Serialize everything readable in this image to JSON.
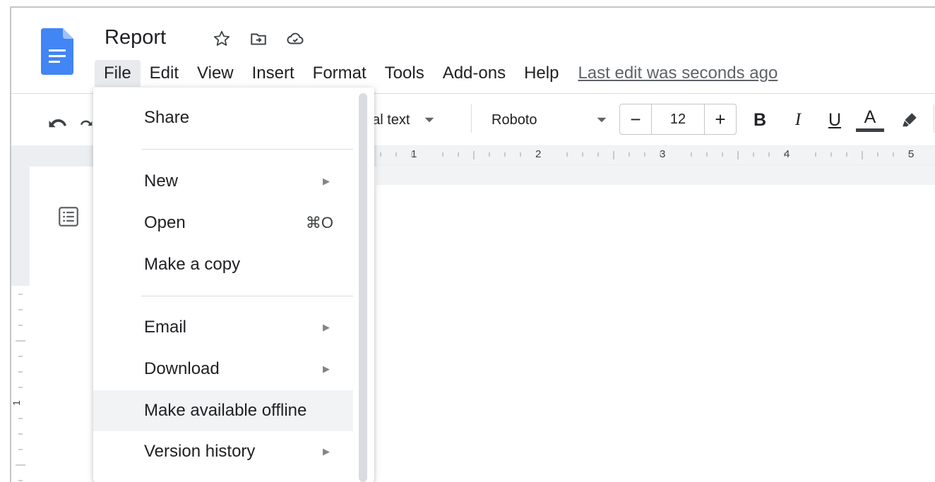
{
  "app": {
    "title": "Report",
    "last_edit": "Last edit was seconds ago"
  },
  "menubar": {
    "items": [
      "File",
      "Edit",
      "View",
      "Insert",
      "Format",
      "Tools",
      "Add-ons",
      "Help"
    ]
  },
  "toolbar": {
    "style_label": "nal text",
    "font_label": "Roboto",
    "font_size": "12",
    "minus": "−",
    "plus": "+",
    "bold": "B",
    "italic": "I",
    "underline": "U",
    "text_color": "A"
  },
  "ruler": {
    "numbers": [
      "1",
      "2",
      "3",
      "4",
      "5"
    ],
    "left_number": "1"
  },
  "file_menu": {
    "items": [
      {
        "label": "Share"
      },
      {
        "label": "New"
      },
      {
        "label": "Open",
        "shortcut": "⌘O"
      },
      {
        "label": "Make a copy"
      },
      {
        "label": "Email"
      },
      {
        "label": "Download"
      },
      {
        "label": "Make available offline"
      },
      {
        "label": "Version history"
      }
    ],
    "submenu_arrow": "▶"
  },
  "colors": {
    "doc_blue": "#4285f4",
    "menu_active_bg": "#e8eaed",
    "highlight_bg": "#f1f3f4"
  }
}
